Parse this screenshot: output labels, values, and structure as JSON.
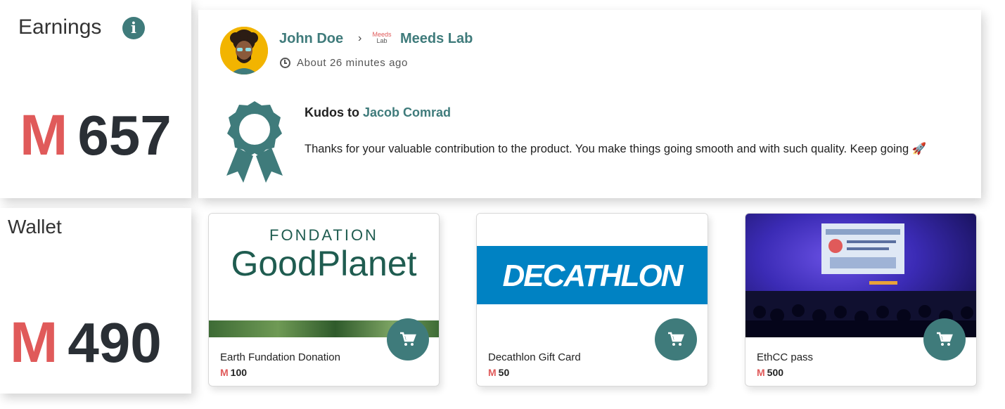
{
  "earnings": {
    "title": "Earnings",
    "currency_symbol": "M",
    "amount": "657",
    "icon": "info-icon"
  },
  "wallet": {
    "title": "Wallet",
    "currency_symbol": "M",
    "amount": "490"
  },
  "activity": {
    "author": "John Doe",
    "separator": "›",
    "space_logo_top": "Meeds",
    "space_logo_bottom": "Lab",
    "space": "Meeds Lab",
    "time": "About 26 minutes ago",
    "kudos_prefix": "Kudos to",
    "kudos_receiver": "Jacob Comrad",
    "message": "Thanks for your valuable contribution to the product. You make things going smooth and with such quality. Keep going 🚀"
  },
  "products": [
    {
      "image_text_top": "FONDATION",
      "image_text_main": "GoodPlanet",
      "title": "Earth Fundation Donation",
      "currency_symbol": "M",
      "price": "100"
    },
    {
      "image_text_main": "DECATHLON",
      "title": "Decathlon Gift Card",
      "currency_symbol": "M",
      "price": "50"
    },
    {
      "title": "EthCC pass",
      "currency_symbol": "M",
      "price": "500"
    }
  ],
  "colors": {
    "accent": "#3f7b7b",
    "currency": "#e05a5a",
    "decathlon_blue": "#0082c3"
  }
}
